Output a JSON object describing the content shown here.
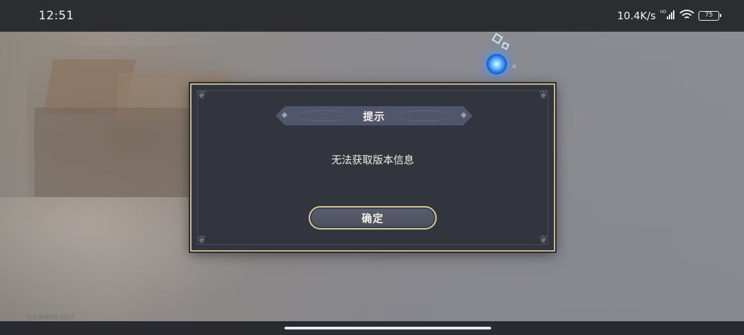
{
  "status_bar": {
    "time": "12:51",
    "net_speed": "10.4K/s",
    "battery_level": "75",
    "icons": [
      "hd-signal-icon",
      "wifi-icon",
      "battery-icon"
    ]
  },
  "dialog": {
    "title": "提示",
    "message": "无法获取版本信息",
    "confirm_label": "确定"
  },
  "footer": {
    "version": "0.0.864995.8517"
  },
  "colors": {
    "dialog_bg": "#32343e",
    "dialog_border": "#c8bb94",
    "button_border": "#d9cb9d",
    "orb": "#5ab6ff"
  }
}
